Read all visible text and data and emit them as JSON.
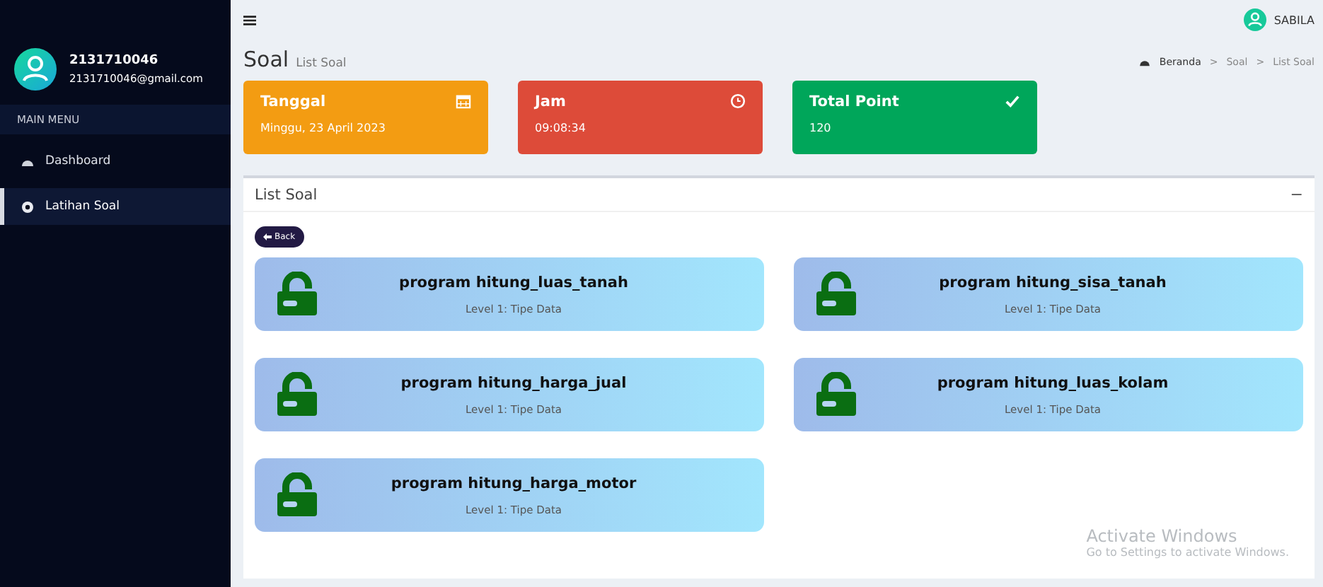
{
  "user": {
    "id": "2131710046",
    "email": "2131710046@gmail.com",
    "top_name": "SABILA"
  },
  "sidebar": {
    "header": "MAIN MENU",
    "items": [
      {
        "label": "Dashboard",
        "kind": "dashboard",
        "selected": false
      },
      {
        "label": "Latihan Soal",
        "kind": "exercise",
        "selected": true
      }
    ]
  },
  "page": {
    "title": "Soal",
    "subtitle": "List Soal",
    "breadcrumb": [
      "Beranda",
      "Soal",
      "List Soal"
    ],
    "separator": ">"
  },
  "stats": [
    {
      "title": "Tanggal",
      "value": "Minggu, 23 April 2023",
      "kind": "calendar",
      "color": "#f39c12"
    },
    {
      "title": "Jam",
      "value": "09:08:34",
      "kind": "clock",
      "color": "#dd4b39"
    },
    {
      "title": "Total Point",
      "value": "120",
      "kind": "check",
      "color": "#00a65a"
    }
  ],
  "panel": {
    "title": "List Soal",
    "collapse": "−",
    "back": "Back"
  },
  "questions": [
    {
      "title": "program hitung_luas_tanah",
      "level": "Level 1: Tipe Data",
      "locked": false
    },
    {
      "title": "program hitung_sisa_tanah",
      "level": "Level 1: Tipe Data",
      "locked": false
    },
    {
      "title": "program hitung_harga_jual",
      "level": "Level 1: Tipe Data",
      "locked": false
    },
    {
      "title": "program hitung_luas_kolam",
      "level": "Level 1: Tipe Data",
      "locked": false
    },
    {
      "title": "program hitung_harga_motor",
      "level": "Level 1: Tipe Data",
      "locked": false
    }
  ],
  "os_notice": {
    "title": "Activate Windows",
    "text": "Go to Settings to activate Windows."
  }
}
